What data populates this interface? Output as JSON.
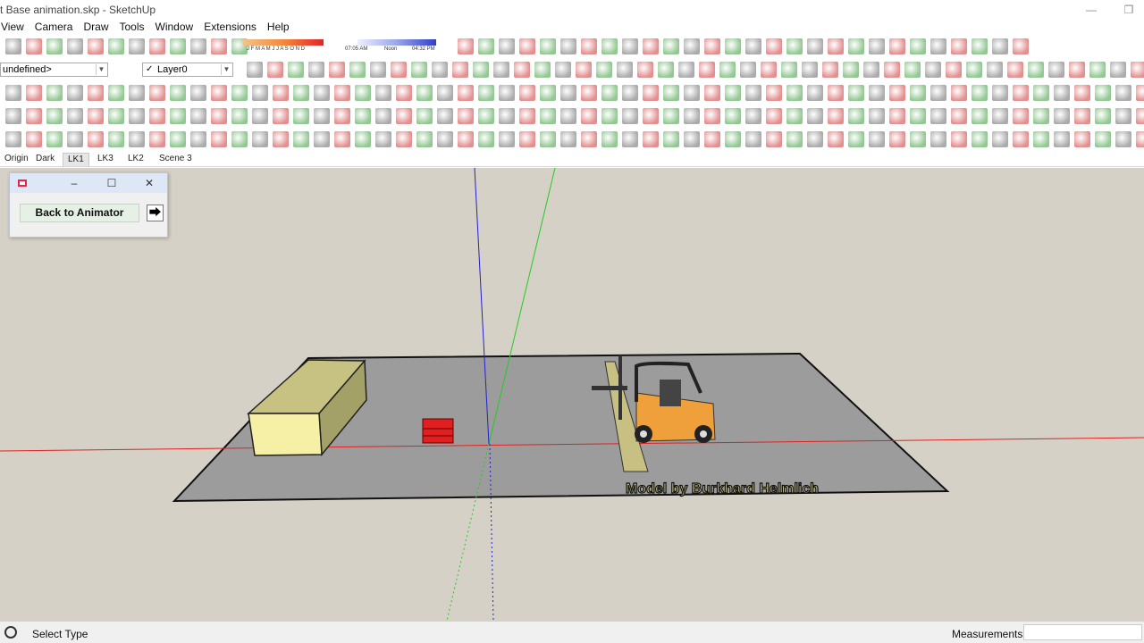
{
  "window": {
    "title": "t Base animation.skp - SketchUp",
    "minimize_glyph": "—",
    "restore_glyph": "❐"
  },
  "menu": {
    "items": [
      "View",
      "Camera",
      "Draw",
      "Tools",
      "Window",
      "Extensions",
      "Help"
    ]
  },
  "toolbar": {
    "layer_selector_value": "undefined>",
    "layer_name": "Layer0",
    "shadow_months": "J F M A M J J A S O N D",
    "shadow_time_start": "07:05 AM",
    "shadow_time_noon": "Noon",
    "shadow_time_end": "04:32 PM"
  },
  "scenes": {
    "tabs": [
      "Origin",
      "Dark",
      "LK1",
      "LK3",
      "LK2",
      "Scene 3"
    ],
    "active_tab": "LK1"
  },
  "dialog": {
    "minimize_glyph": "–",
    "maximize_glyph": "☐",
    "close_glyph": "✕",
    "back_button": "Back to Animator",
    "exit_glyph": "⮕"
  },
  "viewport": {
    "watermark": "Model by Burkhard Helmlich"
  },
  "statusbar": {
    "status_text": "Select Type",
    "measurements_label": "Measurements",
    "measurements_value": ""
  },
  "colors": {
    "viewport_bg": "#d6d1c6",
    "ground": "#9c9c9c",
    "box_front": "#f5f0a5",
    "box_top": "#c7c282",
    "box_side": "#a3a068",
    "forklift_body": "#f0a03a",
    "pallet": "#e02020",
    "axis_red": "#d22",
    "axis_green": "#2c2",
    "axis_blue": "#22c"
  }
}
